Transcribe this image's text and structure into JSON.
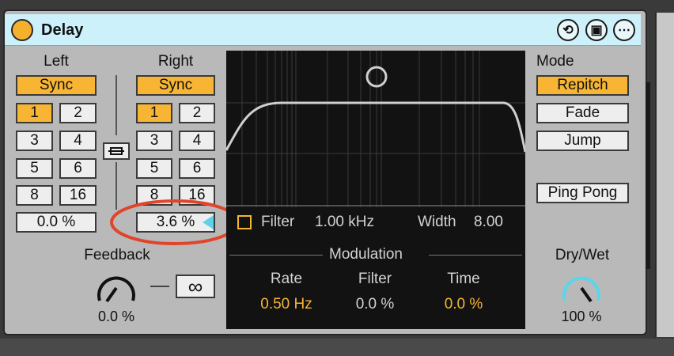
{
  "device": {
    "title": "Delay",
    "header_icons": [
      "refresh-icon",
      "save-icon",
      "more-icon"
    ],
    "header_glyphs": {
      "refresh": "⟲",
      "save": "▣",
      "more": "⋯"
    }
  },
  "left": {
    "label": "Left",
    "sync_label": "Sync",
    "beats": [
      "1",
      "2",
      "3",
      "4",
      "5",
      "6",
      "8",
      "16"
    ],
    "selected_beat": "1",
    "offset_value": "0.0 %"
  },
  "right": {
    "label": "Right",
    "sync_label": "Sync",
    "beats": [
      "1",
      "2",
      "3",
      "4",
      "5",
      "6",
      "8",
      "16"
    ],
    "selected_beat": "1",
    "offset_value": "3.6 %"
  },
  "link_icon": "link-icon",
  "feedback": {
    "label": "Feedback",
    "value": "0.0 %",
    "freeze_label": "∞"
  },
  "filter": {
    "label": "Filter",
    "frequency": "1.00 kHz",
    "width_label": "Width",
    "width_value": "8.00"
  },
  "modulation": {
    "title": "Modulation",
    "columns": [
      {
        "label": "Rate",
        "value": "0.50 Hz"
      },
      {
        "label": "Filter",
        "value": "0.0 %"
      },
      {
        "label": "Time",
        "value": "0.0 %"
      }
    ]
  },
  "mode": {
    "label": "Mode",
    "options": [
      "Repitch",
      "Fade",
      "Jump"
    ],
    "selected": "Repitch",
    "ping_pong_label": "Ping Pong"
  },
  "dry_wet": {
    "label": "Dry/Wet",
    "value": "100 %"
  },
  "colors": {
    "accent": "#f5b533",
    "title_bar": "#cdf1fb",
    "dry_wet_knob": "#58d6ee",
    "highlight_circle": "#e0452c"
  }
}
